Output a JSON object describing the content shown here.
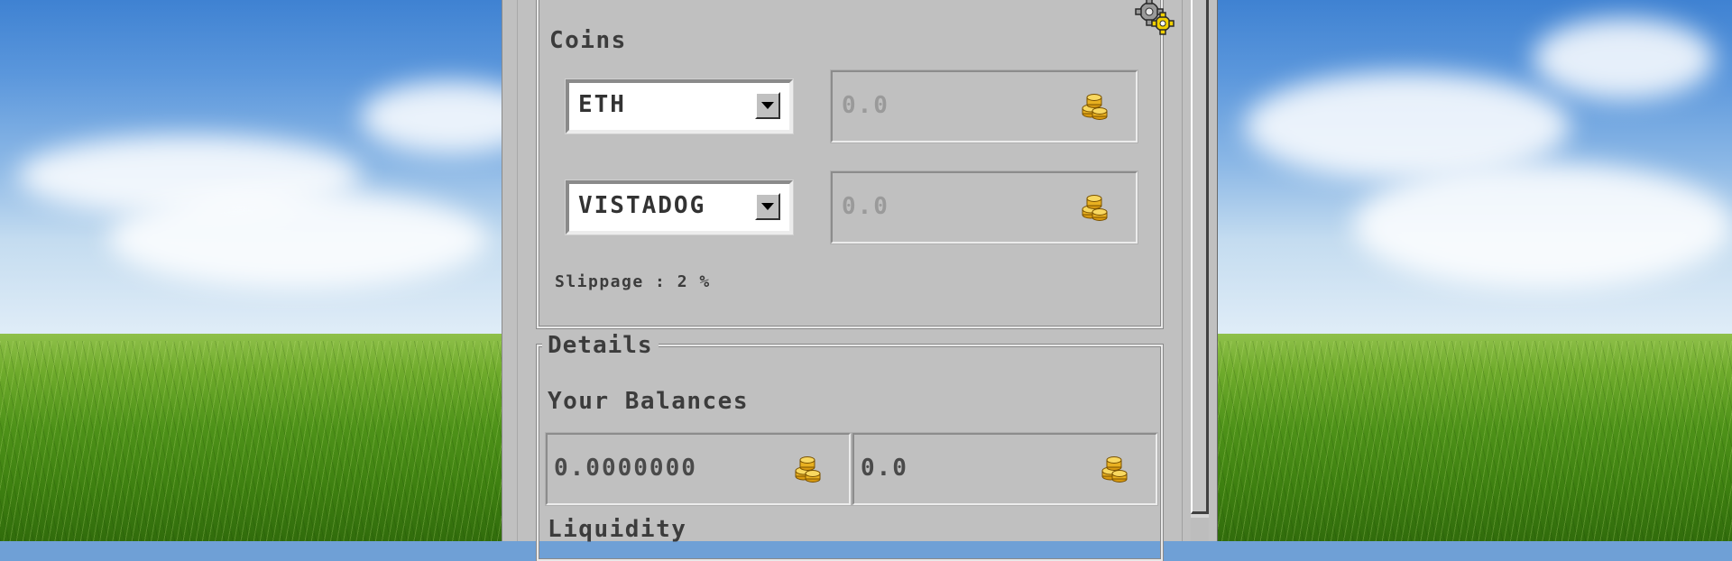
{
  "coins_panel": {
    "title": "Coins",
    "from_token": {
      "selected": "ETH",
      "amount": "0.0"
    },
    "to_token": {
      "selected": "VISTADOG",
      "amount": "0.0"
    },
    "slippage_label": "Slippage : 2 %"
  },
  "details_panel": {
    "title": "Details",
    "balances_label": "Your Balances",
    "balance_from": "0.0000000",
    "balance_to": "0.0",
    "liquidity_label": "Liquidity"
  },
  "icons": {
    "settings": "gear-settings-icon",
    "coins": "coin-stack-icon"
  },
  "colors": {
    "window_bg": "#c0c0c0",
    "text": "#3c3c3c",
    "disabled_text": "#9a9a9a",
    "coin_gold": "#e0a820"
  }
}
